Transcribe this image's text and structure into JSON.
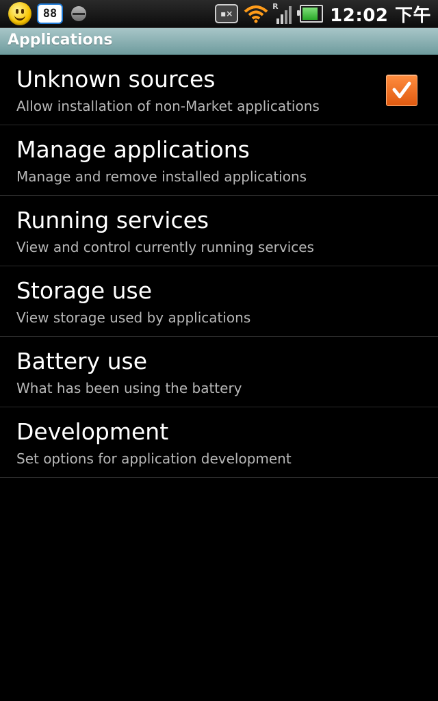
{
  "status_bar": {
    "badge_count": "88",
    "signal_roaming": "R",
    "time": "12:02 下午",
    "battery_level_fraction": 0.85,
    "icons": [
      "smiley-icon",
      "notification-badge-icon",
      "cloud-sync-icon",
      "gamepad-icon",
      "wifi-icon",
      "signal-icon",
      "battery-icon"
    ]
  },
  "title_bar": {
    "title": "Applications"
  },
  "settings": [
    {
      "title": "Unknown sources",
      "summary": "Allow installation of non-Market applications",
      "checked": true
    },
    {
      "title": "Manage applications",
      "summary": "Manage and remove installed applications"
    },
    {
      "title": "Running services",
      "summary": "View and control currently running services"
    },
    {
      "title": "Storage use",
      "summary": "View storage used by applications"
    },
    {
      "title": "Battery use",
      "summary": "What has been using the battery"
    },
    {
      "title": "Development",
      "summary": "Set options for application development"
    }
  ],
  "colors": {
    "background": "#000000",
    "title_bar": "#8fb4b6",
    "checkbox": "#f06a1c",
    "primary_text": "#ffffff",
    "secondary_text": "#b8b8b8",
    "divider": "#2b2b2b"
  }
}
